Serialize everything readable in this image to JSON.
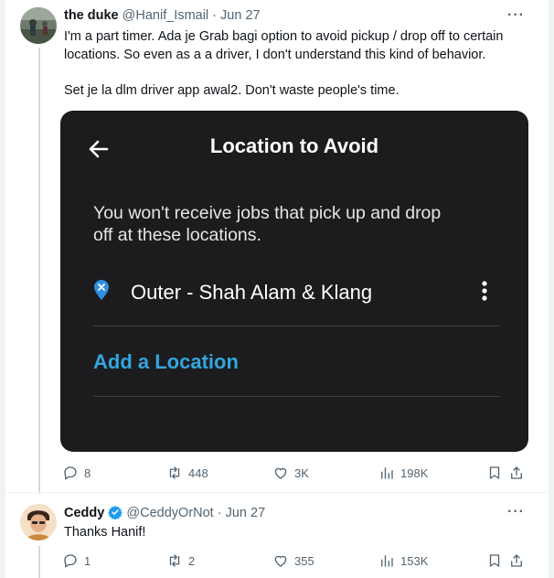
{
  "tweet1": {
    "name": "the duke",
    "handle": "@Hanif_Ismail",
    "separator": " · ",
    "date": "Jun 27",
    "text_line1": "I'm a part timer. Ada je Grab bagi option to avoid pickup / drop off to certain",
    "text_line2": "locations. So even as a a driver, I don't understand this kind of behavior.",
    "text_line3": "Set je la dlm driver app awal2. Don't waste people's time.",
    "media": {
      "title": "Location to Avoid",
      "description_line1": "You won't receive jobs that pick up and drop",
      "description_line2": "off at these locations.",
      "location_name": "Outer - Shah Alam & Klang",
      "add_location": "Add a Location"
    },
    "actions": {
      "replies": "8",
      "retweets": "448",
      "likes": "3K",
      "views": "198K"
    }
  },
  "tweet2": {
    "name": "Ceddy",
    "handle": "@CeddyOrNot",
    "separator": " · ",
    "date": "Jun 27",
    "text": "Thanks Hanif!",
    "actions": {
      "replies": "1",
      "retweets": "2",
      "likes": "355",
      "views": "153K"
    }
  },
  "more_label": "···",
  "colors": {
    "accent": "#1d9bf0",
    "muted": "#536471",
    "media_bg": "#1c1c1e",
    "link_blue": "#33a6de"
  }
}
